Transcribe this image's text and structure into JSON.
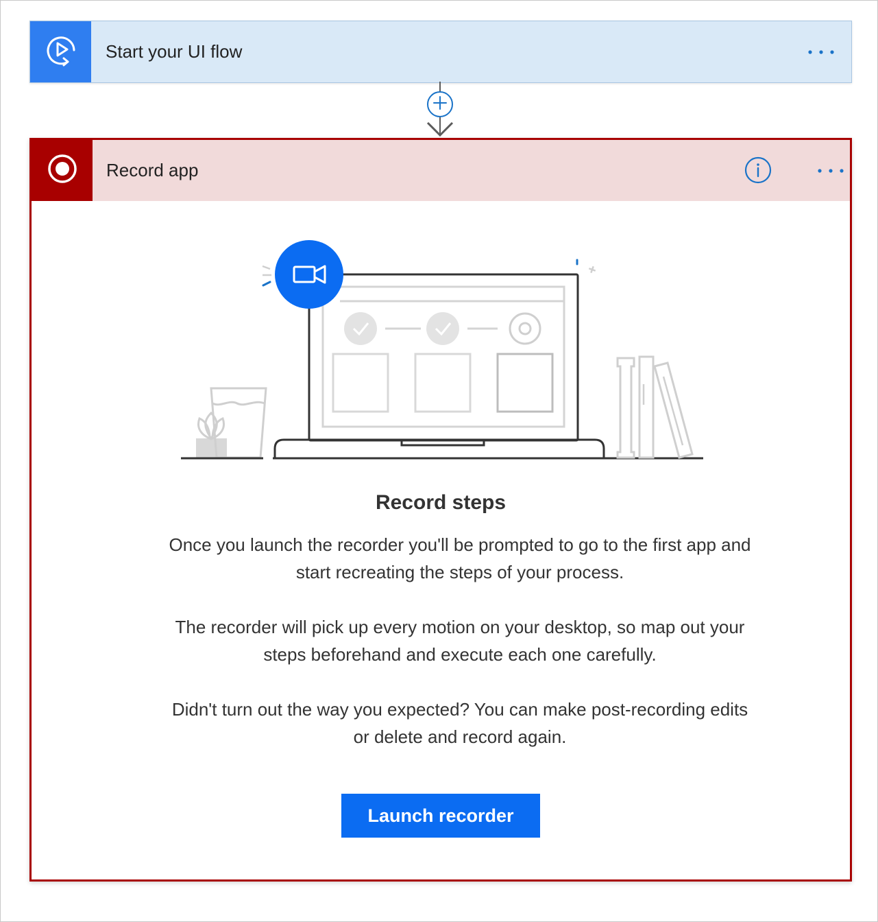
{
  "trigger": {
    "title": "Start your UI flow",
    "icon": "play-circle-icon",
    "more_icon": "more-horizontal-icon",
    "color": "#2f7ef0",
    "background": "#d9e9f7"
  },
  "connector": {
    "add_icon": "plus-icon",
    "arrow_icon": "arrow-down-icon"
  },
  "record_card": {
    "title": "Record app",
    "icon": "record-icon",
    "info_icon": "info-icon",
    "more_icon": "more-horizontal-icon",
    "accent_color": "#a80000",
    "header_background": "#f1dada"
  },
  "content": {
    "heading": "Record steps",
    "paragraph_1": "Once you launch the recorder you'll be prompted to go to the first app and start recreating the steps of your process.",
    "paragraph_2": "The recorder will pick up every motion on your desktop, so map out your steps beforehand and execute each one carefully.",
    "paragraph_3": "Didn't turn out the way you expected? You can make post-recording edits or delete and record again.",
    "launch_label": "Launch recorder",
    "launch_color": "#0b6cf2",
    "illustration_icons": [
      "video-camera-icon",
      "laptop-icon",
      "plant-icon",
      "glass-icon",
      "books-icon"
    ]
  }
}
